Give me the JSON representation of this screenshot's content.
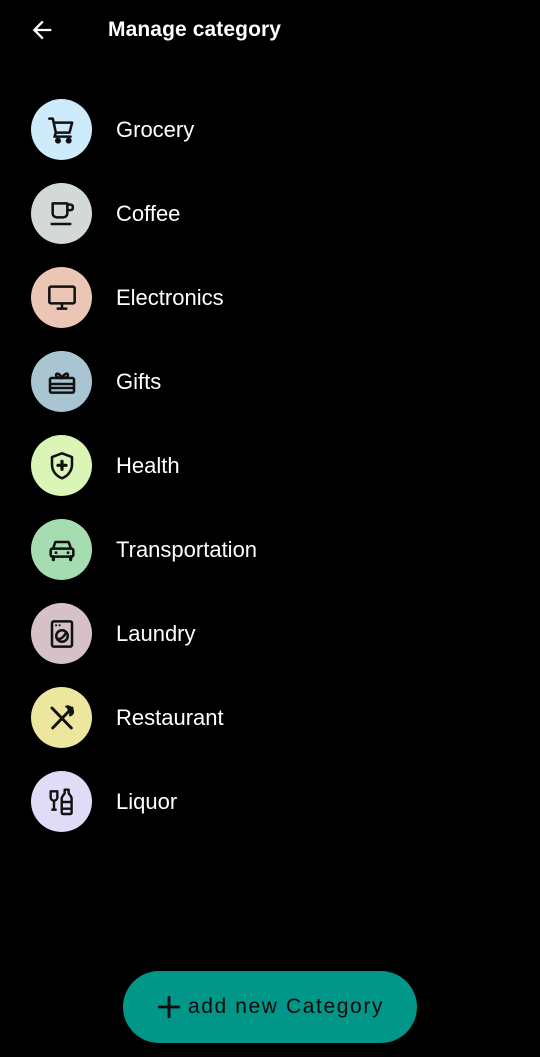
{
  "app_bar": {
    "title": "Manage category",
    "back_icon": "arrow-left-icon"
  },
  "categories": [
    {
      "label": "Grocery",
      "icon": "shopping-cart-icon",
      "color": "#CDEBFA"
    },
    {
      "label": "Coffee",
      "icon": "coffee-cup-icon",
      "color": "#D3D9D6"
    },
    {
      "label": "Electronics",
      "icon": "monitor-icon",
      "color": "#ECC6B5"
    },
    {
      "label": "Gifts",
      "icon": "gift-card-icon",
      "color": "#A9C5D2"
    },
    {
      "label": "Health",
      "icon": "shield-plus-icon",
      "color": "#DBF5B6"
    },
    {
      "label": "Transportation",
      "icon": "car-icon",
      "color": "#A5DDB1"
    },
    {
      "label": "Laundry",
      "icon": "washing-machine-icon",
      "color": "#D6C2C6"
    },
    {
      "label": "Restaurant",
      "icon": "utensils-icon",
      "color": "#ECE69F"
    },
    {
      "label": "Liquor",
      "icon": "liquor-bottle-icon",
      "color": "#E0DBF6"
    }
  ],
  "fab": {
    "label": "add new Category",
    "icon": "plus-icon",
    "color": "#009688"
  },
  "colors": {
    "background": "#000000",
    "text": "#FFFFFF",
    "icon": "#111111"
  }
}
